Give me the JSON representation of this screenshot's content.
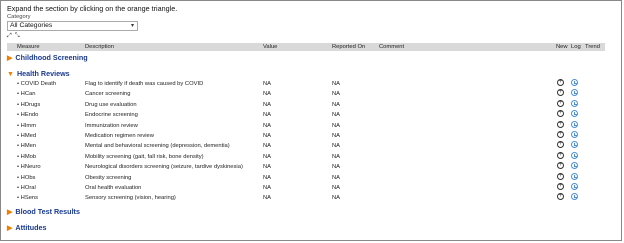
{
  "instruction": "Expand the section by clicking on the orange triangle.",
  "category": {
    "label": "Category",
    "selected": "All Categories"
  },
  "toolbar": {
    "expand_icon": "expand-all-icon",
    "collapse_icon": "collapse-all-icon"
  },
  "table_headers": [
    "Measure",
    "Description",
    "Value",
    "Reported On",
    "Comment",
    "New",
    "Log",
    "Trend"
  ],
  "sections": [
    {
      "title": "Childhood Screening",
      "expanded": false,
      "rows": []
    },
    {
      "title": "Health Reviews",
      "expanded": true,
      "rows": [
        {
          "measure": "• COVID Death",
          "description": "Flag to identify if death was caused by COVID",
          "value": "NA",
          "reported_on": "NA"
        },
        {
          "measure": "• HCan",
          "description": "Cancer screening",
          "value": "NA",
          "reported_on": "NA"
        },
        {
          "measure": "• HDrugs",
          "description": "Drug use evaluation",
          "value": "NA",
          "reported_on": "NA"
        },
        {
          "measure": "• HEndo",
          "description": "Endocrine screening",
          "value": "NA",
          "reported_on": "NA"
        },
        {
          "measure": "• HImm",
          "description": "Immunization review",
          "value": "NA",
          "reported_on": "NA"
        },
        {
          "measure": "• HMed",
          "description": "Medication regimen review",
          "value": "NA",
          "reported_on": "NA"
        },
        {
          "measure": "• HMen",
          "description": "Mental and behavioral screening (depression, dementia)",
          "value": "NA",
          "reported_on": "NA"
        },
        {
          "measure": "• HMob",
          "description": "Mobility screening (gait, fall risk, bone density)",
          "value": "NA",
          "reported_on": "NA"
        },
        {
          "measure": "• HNeuro",
          "description": "Neurological disorders screening (seizure, tardive dyskinesia)",
          "value": "NA",
          "reported_on": "NA"
        },
        {
          "measure": "• HObs",
          "description": "Obesity screening",
          "value": "NA",
          "reported_on": "NA"
        },
        {
          "measure": "• HOral",
          "description": "Oral health evaluation",
          "value": "NA",
          "reported_on": "NA"
        },
        {
          "measure": "• HSens",
          "description": "Sensory screening (vision, hearing)",
          "value": "NA",
          "reported_on": "NA"
        }
      ]
    },
    {
      "title": "Blood Test Results",
      "expanded": false,
      "rows": []
    },
    {
      "title": "Attitudes",
      "expanded": false,
      "rows": []
    }
  ],
  "colors": {
    "triangle": "#f07e00",
    "section_title": "#1a3a8f",
    "header_bg": "#d9d9d9",
    "trend_icon": "#4a8fd6"
  }
}
